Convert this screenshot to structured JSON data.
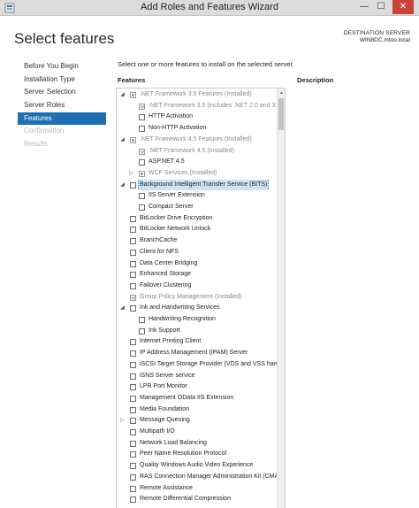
{
  "window": {
    "title": "Add Roles and Features Wizard",
    "minimize": "—",
    "maximize": "☐",
    "close": "✕"
  },
  "header": {
    "title": "Select features",
    "destination_label": "DESTINATION SERVER",
    "destination_server": "WIN8DC.mtoo.local"
  },
  "nav": [
    {
      "label": "Before You Begin",
      "state": "normal"
    },
    {
      "label": "Installation Type",
      "state": "normal"
    },
    {
      "label": "Server Selection",
      "state": "normal"
    },
    {
      "label": "Server Roles",
      "state": "normal"
    },
    {
      "label": "Features",
      "state": "active"
    },
    {
      "label": "Confirmation",
      "state": "disabled"
    },
    {
      "label": "Results",
      "state": "disabled"
    }
  ],
  "content": {
    "instruction": "Select one or more features to install on the selected server.",
    "features_header": "Features",
    "description_header": "Description"
  },
  "features": [
    {
      "label": ".NET Framework 3.5 Features (Installed)",
      "level": 0,
      "expander": "expanded",
      "check": "partial",
      "muted": true
    },
    {
      "label": ".NET Framework 3.5 (includes .NET 2.0 and 3.0)",
      "level": 1,
      "expander": "none",
      "check": "checked",
      "muted": true
    },
    {
      "label": "HTTP Activation",
      "level": 1,
      "expander": "none",
      "check": "unchecked",
      "muted": false
    },
    {
      "label": "Non-HTTP Activation",
      "level": 1,
      "expander": "none",
      "check": "unchecked",
      "muted": false
    },
    {
      "label": ".NET Framework 4.5 Features (Installed)",
      "level": 0,
      "expander": "expanded",
      "check": "partial",
      "muted": true
    },
    {
      "label": ".NET Framework 4.5 (Installed)",
      "level": 1,
      "expander": "none",
      "check": "checked",
      "muted": true
    },
    {
      "label": "ASP.NET 4.5",
      "level": 1,
      "expander": "none",
      "check": "unchecked",
      "muted": false
    },
    {
      "label": "WCF Services (Installed)",
      "level": 1,
      "expander": "collapsed",
      "check": "partial",
      "muted": true
    },
    {
      "label": "Background Intelligent Transfer Service (BITS)",
      "level": 0,
      "expander": "expanded",
      "check": "unchecked",
      "muted": false,
      "selected": true
    },
    {
      "label": "IIS Server Extension",
      "level": 1,
      "expander": "none",
      "check": "unchecked",
      "muted": false
    },
    {
      "label": "Compact Server",
      "level": 1,
      "expander": "none",
      "check": "unchecked",
      "muted": false
    },
    {
      "label": "BitLocker Drive Encryption",
      "level": 0,
      "expander": "none",
      "check": "unchecked",
      "muted": false
    },
    {
      "label": "BitLocker Network Unlock",
      "level": 0,
      "expander": "none",
      "check": "unchecked",
      "muted": false
    },
    {
      "label": "BranchCache",
      "level": 0,
      "expander": "none",
      "check": "unchecked",
      "muted": false
    },
    {
      "label": "Client for NFS",
      "level": 0,
      "expander": "none",
      "check": "unchecked",
      "muted": false
    },
    {
      "label": "Data Center Bridging",
      "level": 0,
      "expander": "none",
      "check": "unchecked",
      "muted": false
    },
    {
      "label": "Enhanced Storage",
      "level": 0,
      "expander": "none",
      "check": "unchecked",
      "muted": false
    },
    {
      "label": "Failover Clustering",
      "level": 0,
      "expander": "none",
      "check": "unchecked",
      "muted": false
    },
    {
      "label": "Group Policy Management (Installed)",
      "level": 0,
      "expander": "none",
      "check": "checked",
      "muted": true
    },
    {
      "label": "Ink and Handwriting Services",
      "level": 0,
      "expander": "expanded",
      "check": "unchecked",
      "muted": false
    },
    {
      "label": "Handwriting Recognition",
      "level": 1,
      "expander": "none",
      "check": "unchecked",
      "muted": false
    },
    {
      "label": "Ink Support",
      "level": 1,
      "expander": "none",
      "check": "unchecked",
      "muted": false
    },
    {
      "label": "Internet Printing Client",
      "level": 0,
      "expander": "none",
      "check": "unchecked",
      "muted": false
    },
    {
      "label": "IP Address Management (IPAM) Server",
      "level": 0,
      "expander": "none",
      "check": "unchecked",
      "muted": false
    },
    {
      "label": "iSCSI Target Storage Provider (VDS and VSS hardware providers)",
      "level": 0,
      "expander": "none",
      "check": "unchecked",
      "muted": false
    },
    {
      "label": "iSNS Server service",
      "level": 0,
      "expander": "none",
      "check": "unchecked",
      "muted": false
    },
    {
      "label": "LPR Port Monitor",
      "level": 0,
      "expander": "none",
      "check": "unchecked",
      "muted": false
    },
    {
      "label": "Management OData IIS Extension",
      "level": 0,
      "expander": "none",
      "check": "unchecked",
      "muted": false
    },
    {
      "label": "Media Foundation",
      "level": 0,
      "expander": "none",
      "check": "unchecked",
      "muted": false
    },
    {
      "label": "Message Queuing",
      "level": 0,
      "expander": "collapsed",
      "check": "unchecked",
      "muted": false
    },
    {
      "label": "Multipath I/O",
      "level": 0,
      "expander": "none",
      "check": "unchecked",
      "muted": false
    },
    {
      "label": "Network Load Balancing",
      "level": 0,
      "expander": "none",
      "check": "unchecked",
      "muted": false
    },
    {
      "label": "Peer Name Resolution Protocol",
      "level": 0,
      "expander": "none",
      "check": "unchecked",
      "muted": false
    },
    {
      "label": "Quality Windows Audio Video Experience",
      "level": 0,
      "expander": "none",
      "check": "unchecked",
      "muted": false
    },
    {
      "label": "RAS Connection Manager Administration Kit (CMAK)",
      "level": 0,
      "expander": "none",
      "check": "unchecked",
      "muted": false
    },
    {
      "label": "Remote Assistance",
      "level": 0,
      "expander": "none",
      "check": "unchecked",
      "muted": false
    },
    {
      "label": "Remote Differential Compression",
      "level": 0,
      "expander": "none",
      "check": "unchecked",
      "muted": false
    }
  ]
}
